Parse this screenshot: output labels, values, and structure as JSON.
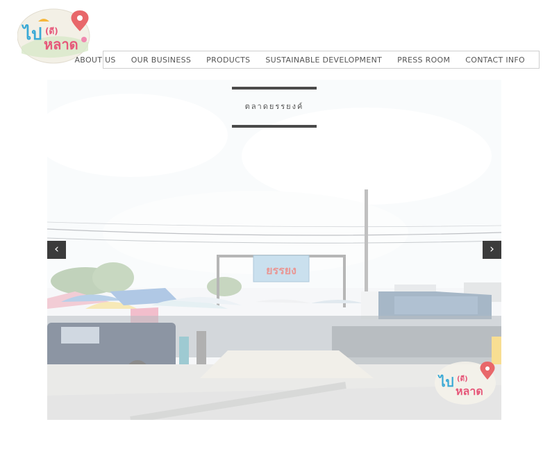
{
  "logo": {
    "text_top": "ไป",
    "text_paren": "(ดี)",
    "text_bottom": "หลาด"
  },
  "nav": {
    "items": [
      {
        "label": "ABOUT US"
      },
      {
        "label": "OUR BUSINESS"
      },
      {
        "label": "PRODUCTS"
      },
      {
        "label": "SUSTAINABLE DEVELOPMENT"
      },
      {
        "label": "PRESS ROOM"
      },
      {
        "label": "CONTACT INFO"
      }
    ]
  },
  "slider": {
    "caption": "ตลาดยรรยงค์",
    "gate_sign": "ยรรยง",
    "prev_label": "‹",
    "next_label": "›"
  },
  "colors": {
    "accent_pink": "#e6587a",
    "accent_blue": "#3aa9d6",
    "caption_bar": "#4a4a4a",
    "arrow_bg": "#3b3b3b"
  },
  "icons": {
    "prev": "chevron-left-icon",
    "next": "chevron-right-icon",
    "pin": "map-pin-icon"
  }
}
